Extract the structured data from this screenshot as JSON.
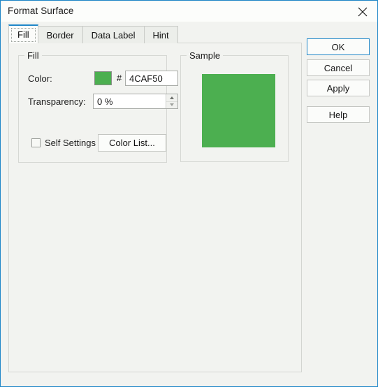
{
  "window": {
    "title": "Format Surface",
    "close_icon": "close-icon"
  },
  "tabs": [
    {
      "label": "Fill",
      "active": true
    },
    {
      "label": "Border",
      "active": false
    },
    {
      "label": "Data Label",
      "active": false
    },
    {
      "label": "Hint",
      "active": false
    }
  ],
  "fill_group": {
    "title": "Fill",
    "color_label": "Color:",
    "color_value": "#4CAF50",
    "hash": "#",
    "hex_value": "4CAF50",
    "transparency_label": "Transparency:",
    "transparency_value": "0 %",
    "spin_up_icon": "spin-up-icon",
    "spin_down_icon": "spin-down-icon",
    "self_settings_label": "Self Settings",
    "self_settings_checked": false,
    "color_list_label": "Color List..."
  },
  "sample_group": {
    "title": "Sample",
    "swatch_color": "#4CAF50"
  },
  "buttons": {
    "ok": "OK",
    "cancel": "Cancel",
    "apply": "Apply",
    "help": "Help"
  },
  "colors": {
    "accent": "#1e86c8",
    "dialog_bg": "#f2f3f0",
    "titlebar_bg": "#fcfdfb",
    "green": "#4CAF50"
  }
}
